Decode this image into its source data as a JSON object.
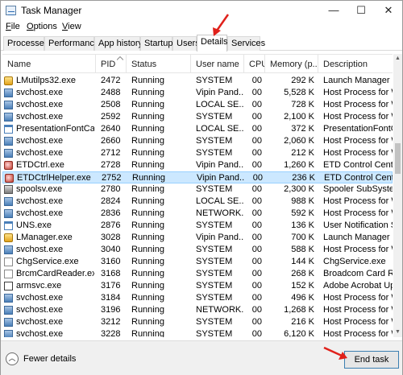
{
  "window": {
    "title": "Task Manager",
    "minimize": "—",
    "maximize": "☐",
    "close": "✕"
  },
  "menu": [
    {
      "label": "File",
      "access_key": "F",
      "rest": "ile"
    },
    {
      "label": "Options",
      "access_key": "O",
      "rest": "ptions"
    },
    {
      "label": "View",
      "access_key": "V",
      "rest": "iew"
    }
  ],
  "tabs": [
    "Processes",
    "Performance",
    "App history",
    "Startup",
    "Users",
    "Details",
    "Services"
  ],
  "active_tab": "Details",
  "columns": [
    "Name",
    "PID",
    "Status",
    "User name",
    "CPU",
    "Memory (p...",
    "Description"
  ],
  "sort_column": "PID",
  "processes": [
    {
      "name": "LMutilps32.exe",
      "pid": "2472",
      "status": "Running",
      "user": "SYSTEM",
      "cpu": "00",
      "memory": "292 K",
      "description": "Launch Manager utility",
      "icon": "lm"
    },
    {
      "name": "svchost.exe",
      "pid": "2488",
      "status": "Running",
      "user": "Vipin Pand...",
      "cpu": "00",
      "memory": "5,528 K",
      "description": "Host Process for Windows",
      "icon": "svc"
    },
    {
      "name": "svchost.exe",
      "pid": "2508",
      "status": "Running",
      "user": "LOCAL SE...",
      "cpu": "00",
      "memory": "728 K",
      "description": "Host Process for Windows",
      "icon": "svc"
    },
    {
      "name": "svchost.exe",
      "pid": "2592",
      "status": "Running",
      "user": "SYSTEM",
      "cpu": "00",
      "memory": "2,100 K",
      "description": "Host Process for Windows",
      "icon": "svc"
    },
    {
      "name": "PresentationFontCac...",
      "pid": "2640",
      "status": "Running",
      "user": "LOCAL SE...",
      "cpu": "00",
      "memory": "372 K",
      "description": "PresentationFontCache",
      "icon": "app"
    },
    {
      "name": "svchost.exe",
      "pid": "2660",
      "status": "Running",
      "user": "SYSTEM",
      "cpu": "00",
      "memory": "2,060 K",
      "description": "Host Process for Windows",
      "icon": "svc"
    },
    {
      "name": "svchost.exe",
      "pid": "2712",
      "status": "Running",
      "user": "SYSTEM",
      "cpu": "00",
      "memory": "212 K",
      "description": "Host Process for Windows",
      "icon": "svc"
    },
    {
      "name": "ETDCtrl.exe",
      "pid": "2728",
      "status": "Running",
      "user": "Vipin Pand...",
      "cpu": "00",
      "memory": "1,260 K",
      "description": "ETD Control Center",
      "icon": "etd"
    },
    {
      "name": "ETDCtrlHelper.exe",
      "pid": "2752",
      "status": "Running",
      "user": "Vipin Pand...",
      "cpu": "00",
      "memory": "236 K",
      "description": "ETD Control Center Helper",
      "icon": "etd",
      "selected": true
    },
    {
      "name": "spoolsv.exe",
      "pid": "2780",
      "status": "Running",
      "user": "SYSTEM",
      "cpu": "00",
      "memory": "2,300 K",
      "description": "Spooler SubSystem App",
      "icon": "print"
    },
    {
      "name": "svchost.exe",
      "pid": "2824",
      "status": "Running",
      "user": "LOCAL SE...",
      "cpu": "00",
      "memory": "988 K",
      "description": "Host Process for Windows",
      "icon": "svc"
    },
    {
      "name": "svchost.exe",
      "pid": "2836",
      "status": "Running",
      "user": "NETWORK...",
      "cpu": "00",
      "memory": "592 K",
      "description": "Host Process for Windows",
      "icon": "svc"
    },
    {
      "name": "UNS.exe",
      "pid": "2876",
      "status": "Running",
      "user": "SYSTEM",
      "cpu": "00",
      "memory": "136 K",
      "description": "User Notification Service",
      "icon": "app"
    },
    {
      "name": "LManager.exe",
      "pid": "3028",
      "status": "Running",
      "user": "Vipin Pand...",
      "cpu": "00",
      "memory": "700 K",
      "description": "Launch Manager",
      "icon": "lm"
    },
    {
      "name": "svchost.exe",
      "pid": "3040",
      "status": "Running",
      "user": "SYSTEM",
      "cpu": "00",
      "memory": "588 K",
      "description": "Host Process for Windows",
      "icon": "svc"
    },
    {
      "name": "ChgService.exe",
      "pid": "3160",
      "status": "Running",
      "user": "SYSTEM",
      "cpu": "00",
      "memory": "144 K",
      "description": "ChgService.exe",
      "icon": "blank"
    },
    {
      "name": "BrcmCardReader.exe",
      "pid": "3168",
      "status": "Running",
      "user": "SYSTEM",
      "cpu": "00",
      "memory": "268 K",
      "description": "Broadcom Card Reader",
      "icon": "blank"
    },
    {
      "name": "armsvc.exe",
      "pid": "3176",
      "status": "Running",
      "user": "SYSTEM",
      "cpu": "00",
      "memory": "152 K",
      "description": "Adobe Acrobat Update",
      "icon": "acro"
    },
    {
      "name": "svchost.exe",
      "pid": "3184",
      "status": "Running",
      "user": "SYSTEM",
      "cpu": "00",
      "memory": "496 K",
      "description": "Host Process for Windows",
      "icon": "svc"
    },
    {
      "name": "svchost.exe",
      "pid": "3196",
      "status": "Running",
      "user": "NETWORK...",
      "cpu": "00",
      "memory": "1,268 K",
      "description": "Host Process for Windows",
      "icon": "svc"
    },
    {
      "name": "svchost.exe",
      "pid": "3212",
      "status": "Running",
      "user": "SYSTEM",
      "cpu": "00",
      "memory": "216 K",
      "description": "Host Process for Windows",
      "icon": "svc"
    },
    {
      "name": "svchost.exe",
      "pid": "3228",
      "status": "Running",
      "user": "SYSTEM",
      "cpu": "00",
      "memory": "6,120 K",
      "description": "Host Process for Windows",
      "icon": "svc"
    }
  ],
  "footer": {
    "fewer_details": "Fewer details",
    "end_task": "End task"
  },
  "colors": {
    "selection": "#cce8ff",
    "selection_border": "#99d1ff",
    "annotation_arrow": "#e0211b",
    "end_task_border": "#3c7fb1"
  },
  "icons": {
    "fewer_details": "chevron-up-icon",
    "svc": "service-gear-icon",
    "etd": "etd-icon",
    "lm": "launch-manager-icon",
    "print": "printer-icon",
    "app": "window-icon",
    "blank": "blank-document-icon",
    "acro": "adobe-icon"
  }
}
